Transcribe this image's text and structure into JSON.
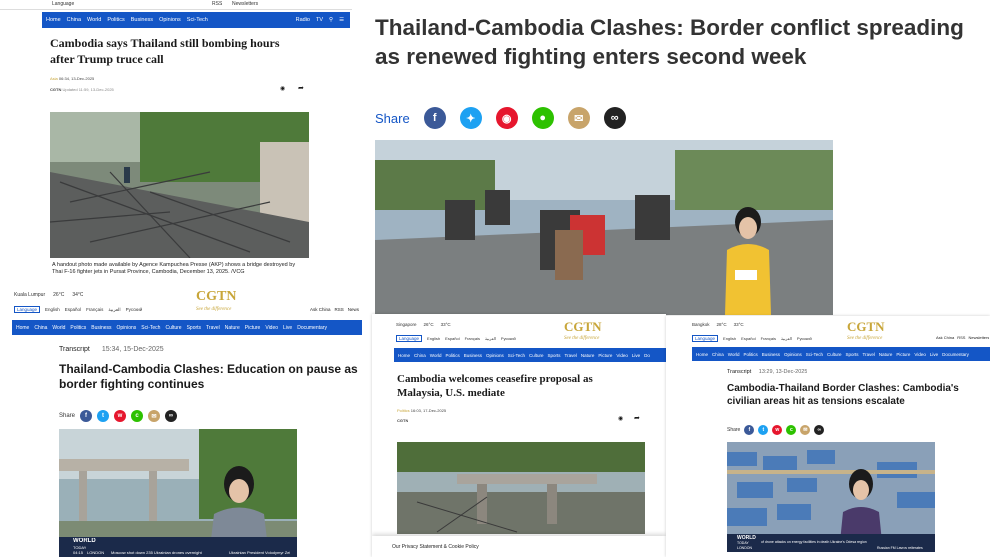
{
  "panel1": {
    "top_items": [
      "Language",
      "RSS",
      "Newsletters"
    ],
    "nav": [
      "Home",
      "China",
      "World",
      "Politics",
      "Business",
      "Opinions",
      "Sci-Tech"
    ],
    "nav_right": [
      "Radio",
      "TV"
    ],
    "headline": "Cambodia says Thailand still bombing hours after Trump truce call",
    "category": "Asia",
    "time": "06:34, 13-Dec-2025",
    "source": "CGTN",
    "updated": "Updated 11:59, 13-Dec-2025",
    "caption": "A handout photo made available by Agence Kampuchea Presse (AKP) shows a bridge destroyed by Thai F-16 fighter jets in Pursat Province, Cambodia, December 13, 2025. /VCG"
  },
  "panel2": {
    "city": "Kuala Lumpur",
    "temp1": "26°C",
    "temp2": "34°C",
    "logo": "CGTN",
    "logo_tagline": "See the difference",
    "right_links": [
      "Ask China",
      "RSS",
      "News"
    ],
    "languages": [
      "English",
      "Español",
      "Français",
      "العربية",
      "Pусский"
    ],
    "language_btn": "Language",
    "nav": [
      "Home",
      "China",
      "World",
      "Politics",
      "Business",
      "Opinions",
      "Sci-Tech",
      "Culture",
      "Sports",
      "Travel",
      "Nature",
      "Picture",
      "Video",
      "Live",
      "Documentary"
    ],
    "label": "Transcript",
    "time": "15:34, 15-Dec-2025",
    "headline": "Thailand-Cambodia Clashes: Education on pause as border fighting continues",
    "share": "Share",
    "ticker_brand": "WORLD",
    "ticker_sub": "TODAY",
    "ticker_city": "LONDON",
    "ticker_time": "04:15",
    "ticker_text": "Moscow shot down 235 Ukrainian drones overnight",
    "ticker_text2": "Ukrainian President Volodymyr Zel"
  },
  "main": {
    "headline": "Thailand-Cambodia Clashes: Border conflict spreading as renewed fighting enters second week",
    "share": "Share",
    "icons": [
      "facebook-icon",
      "twitter-icon",
      "weibo-icon",
      "wechat-icon",
      "email-icon",
      "link-icon"
    ],
    "colors": {
      "facebook": "#3b5998",
      "twitter": "#1da1f2",
      "weibo": "#e6162d",
      "wechat": "#2dc100",
      "email": "#c8a46a",
      "link": "#222222"
    }
  },
  "panel3": {
    "city": "Singapore",
    "temp1": "26°C",
    "temp2": "33°C",
    "logo": "CGTN",
    "logo_tagline": "See the difference",
    "language_btn": "Language",
    "languages": [
      "English",
      "Español",
      "Français",
      "العربية",
      "Pусский"
    ],
    "nav": [
      "Home",
      "China",
      "World",
      "Politics",
      "Business",
      "Opinions",
      "Sci-Tech",
      "Culture",
      "Sports",
      "Travel",
      "Nature",
      "Picture",
      "Video",
      "Live",
      "Do"
    ],
    "headline": "Cambodia welcomes ceasefire proposal as Malaysia, U.S. mediate",
    "category": "Politics",
    "time": "16:03, 17-Dec-2025",
    "source": "CGTN",
    "privacy": "Our Privacy Statement & Cookie Policy"
  },
  "panel4": {
    "city": "Bangkok",
    "temp1": "28°C",
    "temp2": "33°C",
    "logo": "CGTN",
    "logo_tagline": "See the difference",
    "language_btn": "Language",
    "languages": [
      "English",
      "Español",
      "Français",
      "العربية",
      "Pусский"
    ],
    "right_links": [
      "Ask China",
      "RSS",
      "Newsletters"
    ],
    "nav": [
      "Home",
      "China",
      "World",
      "Politics",
      "Business",
      "Opinions",
      "Sci-Tech",
      "Culture",
      "Sports",
      "Travel",
      "Nature",
      "Picture",
      "Video",
      "Live",
      "Documentary"
    ],
    "label": "Transcript",
    "time": "13:29, 13-Dec-2025",
    "headline": "Cambodia-Thailand Border Clashes: Cambodia's civilian areas hit as tensions escalate",
    "share": "Share",
    "ticker_brand": "WORLD",
    "ticker_sub": "TODAY",
    "ticker_city": "LONDON",
    "ticker_text": "of drone attacks on energy facilities in death Ukraine's Odesa region",
    "ticker_text2": "Russian FM Lavrov reiterates"
  }
}
